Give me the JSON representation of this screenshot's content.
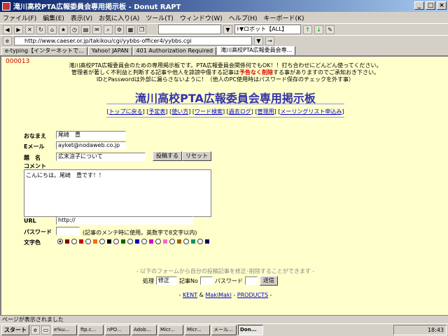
{
  "window": {
    "title": "滝川高校PTA広報委員会専用掲示板 - Donut RAPT"
  },
  "menu": [
    "ファイル(F)",
    "編集(E)",
    "表示(V)",
    "お気に入り(A)",
    "ツール(T)",
    "ウィンドウ(W)",
    "ヘルプ(H)",
    "キーボード(K)"
  ],
  "toolbar": {
    "search_combo": "",
    "robot_combo": "ﾄ▼ロボット【ALL】"
  },
  "address": {
    "url": "http://www.caeser.or.jp/takikou/cgi/yybbs-officer4/yybbs.cgi"
  },
  "tabs": [
    {
      "label": "e-typing【インターネットで...",
      "active": false
    },
    {
      "label": "Yahoo! JAPAN",
      "active": false
    },
    {
      "label": "401 Authorization Required",
      "active": false
    },
    {
      "label": "滝川高校PTA広報委員会専...",
      "active": true
    }
  ],
  "page": {
    "counter": "000013",
    "intro1": "滝川高校PTA広報委員会のための専用掲示板です。PTA広報委員会関係何でもOK！！打ち合わせにどんどん使ってください。",
    "intro2a": "管理者が著しく不利益と判断する記事や他人を誹謗中傷する記事は",
    "intro2b": "予告なく削除",
    "intro2c": "する事がありますのでご承知おき下さい。",
    "intro3": "IDとPasswordは外部に漏らさないように！（他人のPC使用時はパスワード保存のチェックを外す事）",
    "heading": "滝川高校PTA広報委員会専用掲示板",
    "nav": [
      "トップに戻る",
      "予定表",
      "使い方",
      "ワード検索",
      "過去ログ",
      "管理用",
      "メーリングリスト申込み"
    ]
  },
  "form": {
    "name_label": "おなまえ",
    "name_value": "尾崎　豊",
    "email_label": "Eメール",
    "email_value": "ayket@nodaweb.co.jp",
    "subject_label": "題　名",
    "subject_value": "広末涼子について",
    "submit_label": "投稿する",
    "reset_label": "リセット",
    "comment_label": "コメント",
    "comment_value": "こんにちは。尾崎　豊です！！",
    "url_label": "URL",
    "url_value": "http://",
    "password_label": "パスワード",
    "password_note": "(記事のメンテ時に使用。英数字で8文字以内)",
    "color_label": "文字色"
  },
  "colors": [
    "#800000",
    "#cc0000",
    "#ff6600",
    "#000000",
    "#006600",
    "#0000cc",
    "#cc00cc",
    "#ff66cc",
    "#996600",
    "#009966",
    "#000066"
  ],
  "edit": {
    "note": "- 以下のフォームから自分の投稿記事を修正･削除することができます -",
    "action_label": "処理",
    "action_value": "修正",
    "no_label": "記事No",
    "pw_label": "パスワード",
    "send_label": "送信"
  },
  "credits": {
    "kent": "KENT",
    "amp": "&",
    "makimaki": "MakiMaki",
    "dash": "-",
    "products": "PRODUCTS"
  },
  "status": {
    "text": "ページが表示されました"
  },
  "taskbar": {
    "start": "スタート",
    "tasks": [
      "e%u...",
      "ftp.c...",
      "nPO...",
      "Adob...",
      "Micr...",
      "Micr...",
      "メール...",
      "Don..."
    ],
    "clock": "18:43"
  }
}
